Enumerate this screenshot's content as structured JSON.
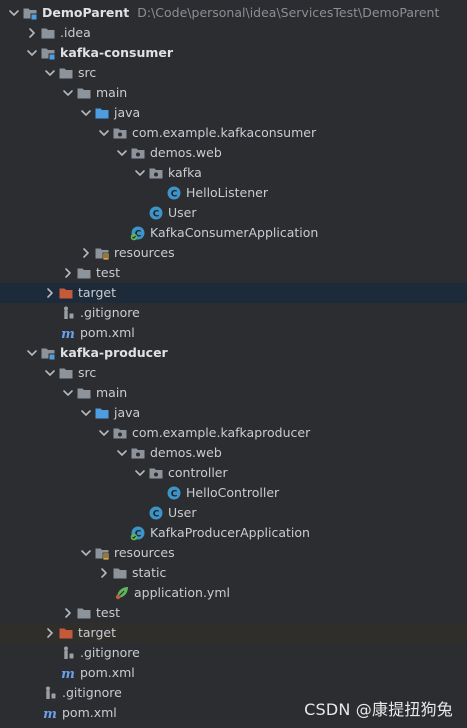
{
  "colors": {
    "background": "#2b2d30",
    "selection": "#1c2a3a",
    "folder": "#8d939b",
    "source_folder": "#4e9de0",
    "class": "#3d94c8",
    "excluded": "#c55a3b"
  },
  "tree": {
    "root": {
      "label": "DemoParent",
      "path": "D:\\Code\\personal\\idea\\ServicesTest\\DemoParent"
    },
    "idea": "idea",
    "consumer": {
      "module": "kafka-consumer",
      "src": "src",
      "main": "main",
      "java": "java",
      "package": "com.example.kafkaconsumer",
      "demos": "demos.web",
      "kafka": "kafka",
      "listener": "HelloListener",
      "user": "User",
      "app": "KafkaConsumerApplication",
      "resources": "resources",
      "test": "test",
      "target": "target",
      "gitignore": ".gitignore",
      "pom": "pom.xml"
    },
    "producer": {
      "module": "kafka-producer",
      "src": "src",
      "main": "main",
      "java": "java",
      "package": "com.example.kafkaproducer",
      "demos": "demos.web",
      "controller": "controller",
      "controller_class": "HelloController",
      "user": "User",
      "app": "KafkaProducerApplication",
      "resources": "resources",
      "static": "static",
      "yml": "application.yml",
      "test": "test",
      "target": "target",
      "gitignore": ".gitignore",
      "pom": "pom.xml"
    },
    "root_gitignore": ".gitignore",
    "root_pom": "pom.xml"
  },
  "watermark": "CSDN @康提扭狗兔"
}
